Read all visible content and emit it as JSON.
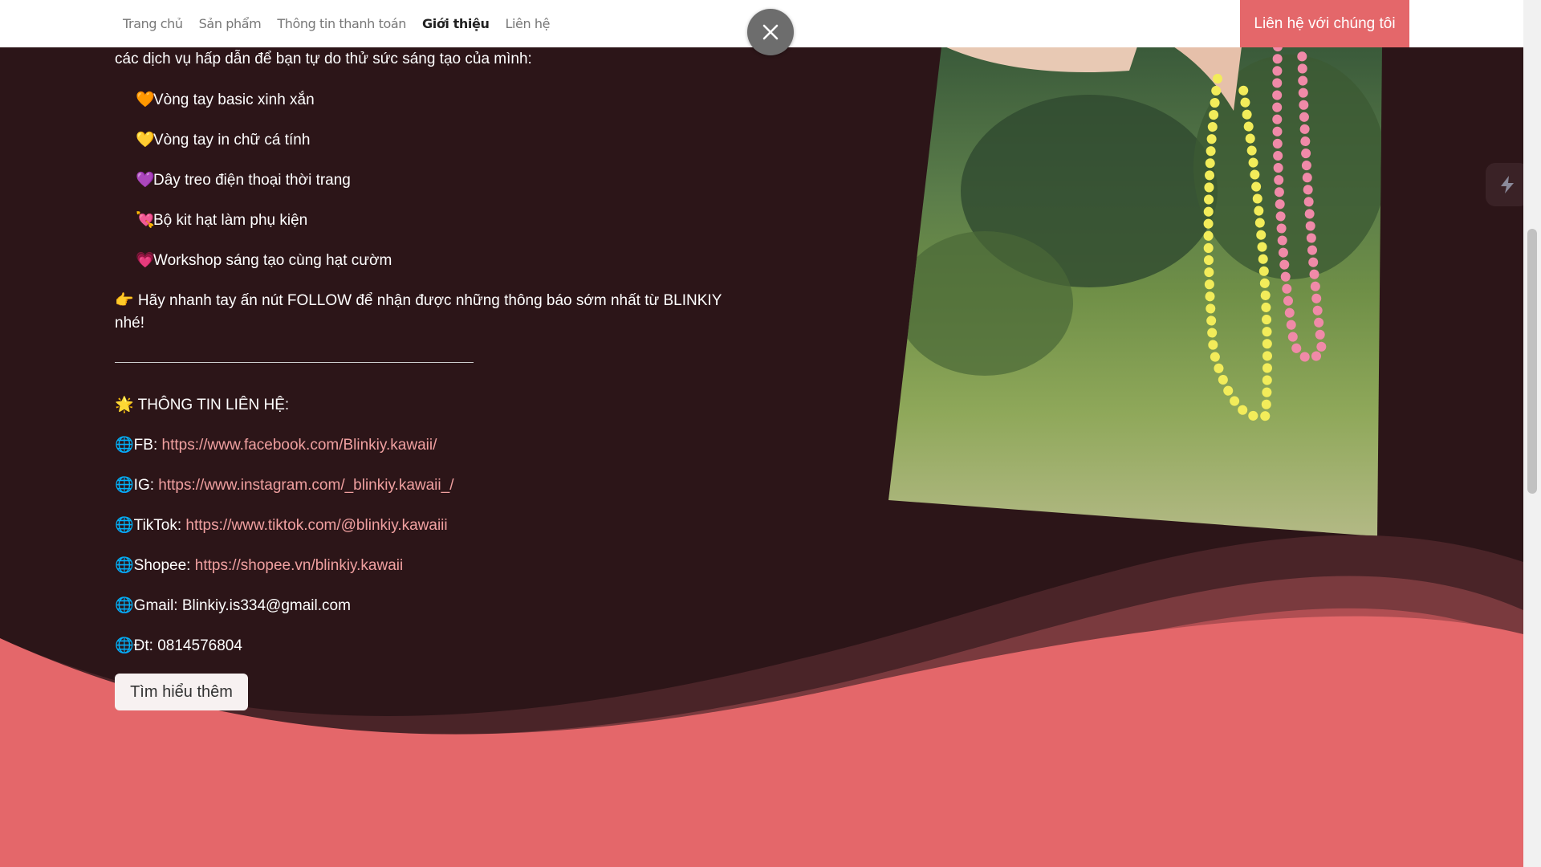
{
  "nav": {
    "links": [
      "Trang chủ",
      "Sản phẩm",
      "Thông tin thanh toán",
      "Giới thiệu",
      "Liên hệ"
    ],
    "active_index": 3,
    "cta_label": "Liên hệ với chúng tôi"
  },
  "intro_text": "các dịch vụ hấp dẫn để bạn tự do thử sức sáng tạo của mình:",
  "services": [
    {
      "icon": "orange-heart-icon",
      "emoji": "🧡",
      "label": "Vòng tay basic xinh xắn"
    },
    {
      "icon": "yellow-heart-icon",
      "emoji": "💛",
      "label": "Vòng tay in chữ cá tính"
    },
    {
      "icon": "purple-heart-icon",
      "emoji": "💜",
      "label": "Dây treo điện thoại thời trang"
    },
    {
      "icon": "heart-arrow-icon",
      "emoji": "💘",
      "label": "Bộ kit hạt làm phụ kiện"
    },
    {
      "icon": "pink-heart-icon",
      "emoji": "💗",
      "label": "Workshop sáng tạo cùng hạt cườm"
    }
  ],
  "follow_text_1": "👉 Hãy nhanh tay ấn nút FOLLOW để nhận được những thông báo sớm nhất từ BLINKIY",
  "follow_text_2": "nhé!",
  "contact_heading": "🌟 THÔNG TIN LIÊN HỆ:",
  "contacts": [
    {
      "label": "FB: ",
      "value": "https://www.facebook.com/Blinkiy.kawaii/",
      "is_link": true
    },
    {
      "label": "IG: ",
      "value": "https://www.instagram.com/_blinkiy.kawaii_/",
      "is_link": true
    },
    {
      "label": "TikTok: ",
      "value": "https://www.tiktok.com/@blinkiy.kawaiii",
      "is_link": true
    },
    {
      "label": "Shopee: ",
      "value": "https://shopee.vn/blinkiy.kawaii",
      "is_link": true
    },
    {
      "label": "Gmail: ",
      "value": "Blinkiy.is334@gmail.com",
      "is_link": false
    },
    {
      "label": "Đt: ",
      "value": "0814576804",
      "is_link": false
    }
  ],
  "globe_emoji": "🌐",
  "learn_more_label": "Tìm hiểu thêm",
  "colors": {
    "accent": "#e4676a",
    "background": "#2c1518",
    "link": "#f0a0a0"
  }
}
